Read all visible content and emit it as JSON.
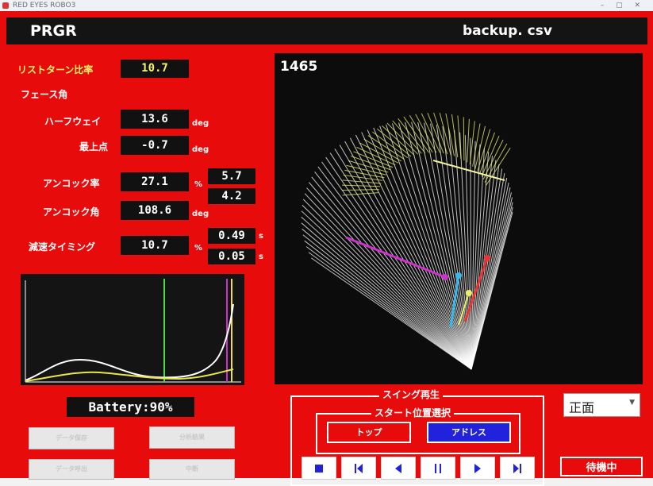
{
  "window": {
    "title": "RED EYES ROBO3"
  },
  "header": {
    "left": "PRGR",
    "right": "backup. csv"
  },
  "metrics": {
    "wrist_return_label": "リストターン比率",
    "wrist_return_value": "10.7",
    "face_angle_label": "フェース角",
    "halfway_label": "ハーフウェイ",
    "halfway_value": "13.6",
    "halfway_unit": "deg",
    "top_label": "最上点",
    "top_value": "-0.7",
    "top_unit": "deg",
    "uncock_rate_label": "アンコック率",
    "uncock_rate_value": "27.1",
    "uncock_rate_unit": "%",
    "uncock_rate_extra1": "5.7",
    "uncock_rate_extra2": "4.2",
    "uncock_angle_label": "アンコック角",
    "uncock_angle_value": "108.6",
    "uncock_angle_unit": "deg",
    "decel_label": "減速タイミング",
    "decel_value": "10.7",
    "decel_unit": "%",
    "decel_extra1": "0.49",
    "decel_extra1_unit": "s",
    "decel_extra2": "0.05",
    "decel_extra2_unit": "s"
  },
  "battery": {
    "text": "Battery:90%"
  },
  "viewer": {
    "frame": "1465"
  },
  "left_buttons": [
    "データ保存",
    "分析結果",
    "データ呼出",
    "中断"
  ],
  "playback": {
    "title": "スイング再生",
    "start_title": "スタート位置選択",
    "top_button": "トップ",
    "address_button": "アドレス",
    "controls": [
      "stop-icon",
      "skip-to-start-icon",
      "step-back-icon",
      "pause-icon",
      "step-forward-icon",
      "skip-to-end-icon"
    ]
  },
  "view_select": {
    "value": "正面"
  },
  "status": {
    "text": "待機中"
  },
  "colors": {
    "app_red": "#e80b0b",
    "panel_black": "#0c0c0c",
    "highlight_yellow": "#f4f26a",
    "address_blue": "#2222dd"
  }
}
